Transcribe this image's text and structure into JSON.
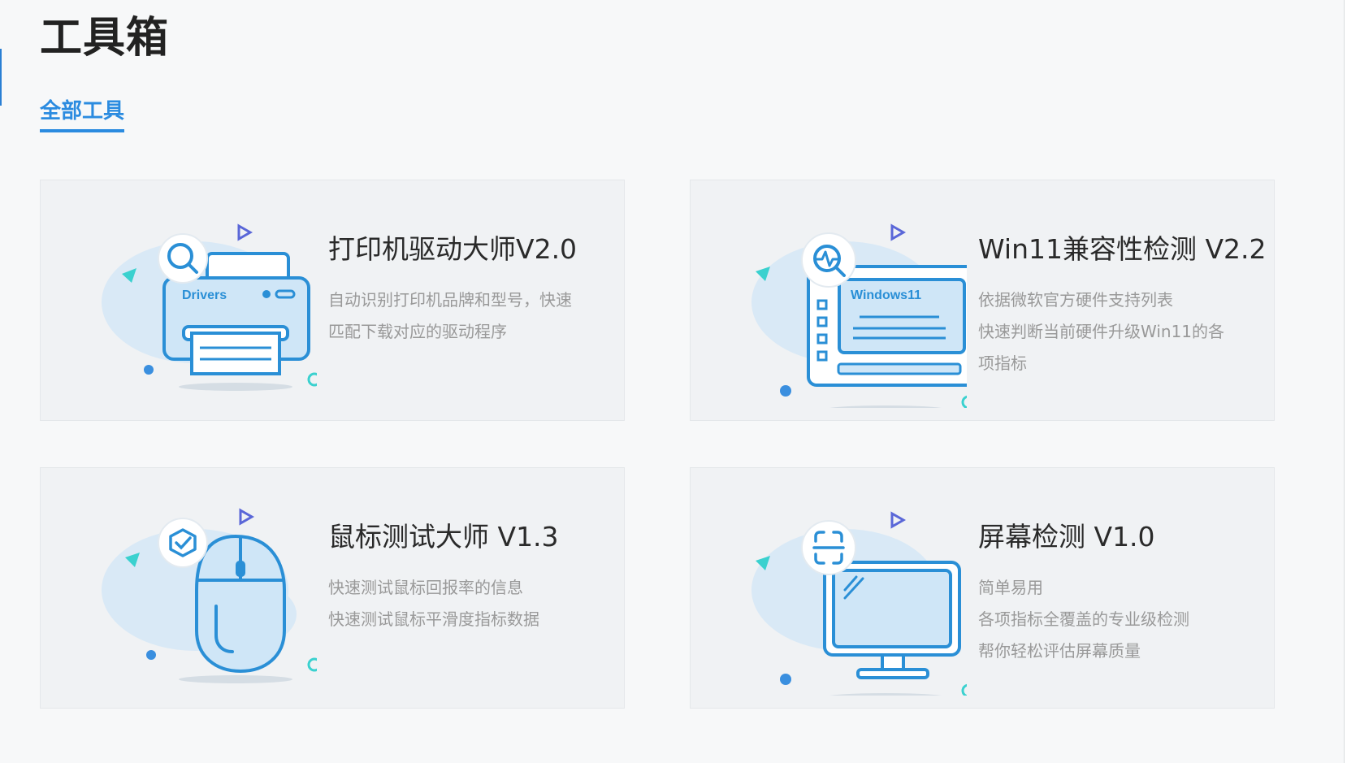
{
  "page": {
    "title": "工具箱"
  },
  "tabs": [
    {
      "label": "全部工具",
      "active": true
    }
  ],
  "cards": [
    {
      "title": "打印机驱动大师V2.0",
      "desc": [
        "自动识别打印机品牌和型号，快速",
        "匹配下载对应的驱动程序"
      ],
      "illustration_text": "Drivers",
      "badge_icon": "search-icon"
    },
    {
      "title": "Win11兼容性检测 V2.2",
      "desc": [
        "依据微软官方硬件支持列表",
        "快速判断当前硬件升级Win11的各",
        "项指标"
      ],
      "illustration_text": "Windows11",
      "badge_icon": "pulse-search-icon"
    },
    {
      "title": "鼠标测试大师 V1.3",
      "desc": [
        "快速测试鼠标回报率的信息",
        "快速测试鼠标平滑度指标数据"
      ],
      "badge_icon": "shield-check-icon"
    },
    {
      "title": "屏幕检测 V1.0",
      "desc": [
        "简单易用",
        "各项指标全覆盖的专业级检测",
        "帮你轻松评估屏幕质量"
      ],
      "badge_icon": "scan-icon"
    }
  ],
  "colors": {
    "accent": "#2b8be0",
    "illustration_stroke": "#2a8fd6",
    "illustration_fill": "#cfe6f7",
    "decor_teal": "#3ad1cf",
    "decor_purple": "#5a67d8"
  }
}
